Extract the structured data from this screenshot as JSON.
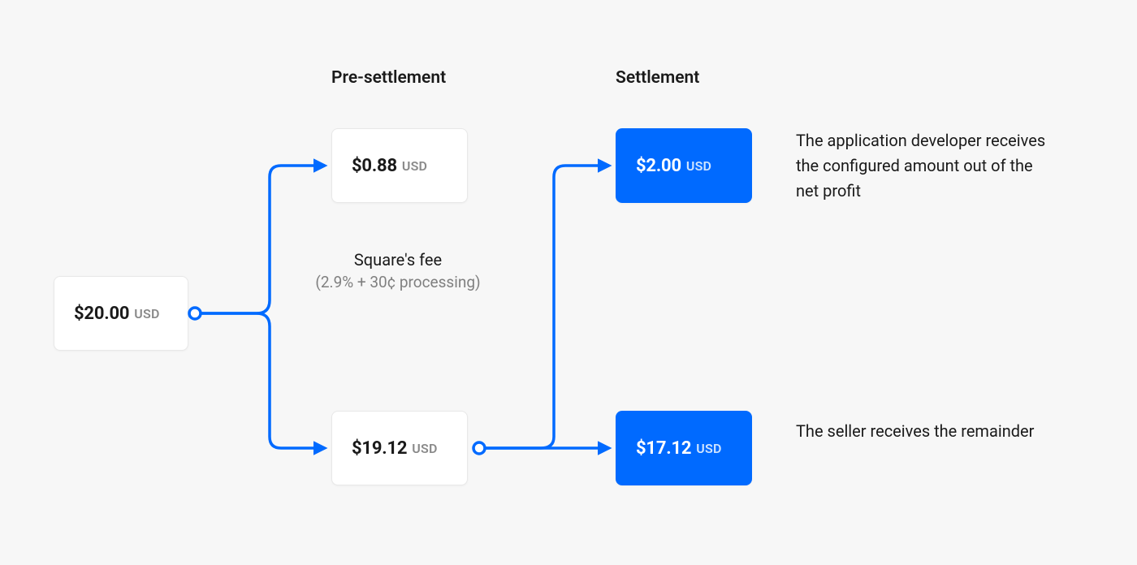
{
  "headers": {
    "pre_settlement": "Pre-settlement",
    "settlement": "Settlement"
  },
  "source": {
    "amount": "$20.00",
    "currency": "USD"
  },
  "pre_settlement": {
    "fee": {
      "amount": "$0.88",
      "currency": "USD"
    },
    "fee_caption": {
      "line1": "Square's fee",
      "line2": "(2.9% + 30¢ processing)"
    },
    "net": {
      "amount": "$19.12",
      "currency": "USD"
    }
  },
  "settlement": {
    "developer": {
      "amount": "$2.00",
      "currency": "USD",
      "text": "The application developer receives the configured amount out of the net profit"
    },
    "seller": {
      "amount": "$17.12",
      "currency": "USD",
      "text": "The seller receives the remainder"
    }
  },
  "colors": {
    "accent": "#006aff"
  }
}
